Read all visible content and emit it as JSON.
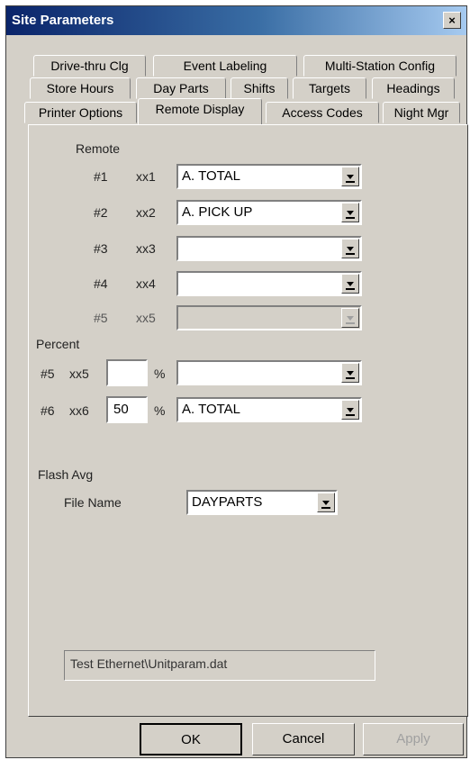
{
  "window": {
    "title": "Site Parameters",
    "close_label": "×"
  },
  "tabs": {
    "row1": [
      "Drive-thru Clg",
      "Event Labeling",
      "Multi-Station Config"
    ],
    "row2": [
      "Store Hours",
      "Day Parts",
      "Shifts",
      "Targets",
      "Headings"
    ],
    "row3": [
      "Printer Options",
      "Remote Display",
      "Access Codes",
      "Night Mgr"
    ]
  },
  "remote": {
    "section_label": "Remote",
    "rows": [
      {
        "num": "#1",
        "code": "xx1",
        "value": "A. TOTAL"
      },
      {
        "num": "#2",
        "code": "xx2",
        "value": "A. PICK UP"
      },
      {
        "num": "#3",
        "code": "xx3",
        "value": ""
      },
      {
        "num": "#4",
        "code": "xx4",
        "value": ""
      },
      {
        "num": "#5",
        "code": "xx5",
        "value": ""
      }
    ]
  },
  "percent": {
    "section_label": "Percent",
    "rows": [
      {
        "num": "#5",
        "code": "xx5",
        "percent": "",
        "symbol": "%",
        "value": ""
      },
      {
        "num": "#6",
        "code": "xx6",
        "percent": "50",
        "symbol": "%",
        "value": "A. TOTAL"
      }
    ]
  },
  "flash": {
    "section_label": "Flash Avg",
    "file_label": "File Name",
    "file_value": "DAYPARTS"
  },
  "path": "Test Ethernet\\Unitparam.dat",
  "buttons": {
    "ok": "OK",
    "cancel": "Cancel",
    "apply": "Apply"
  }
}
